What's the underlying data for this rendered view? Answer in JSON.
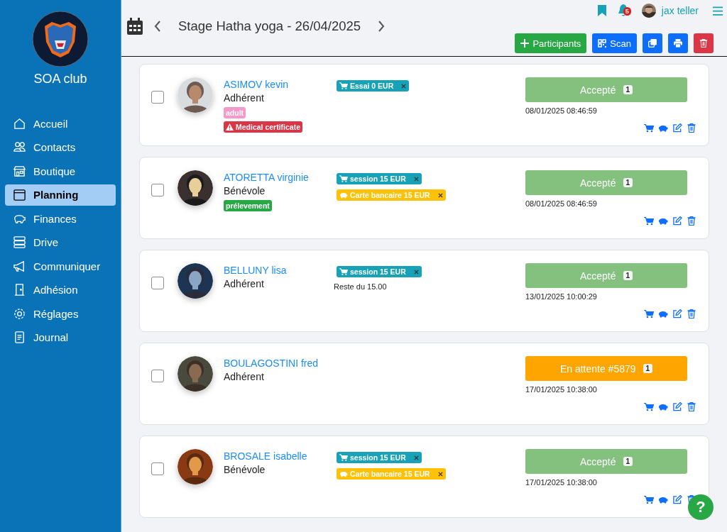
{
  "sidebar": {
    "club_name": "SOA club",
    "items": [
      {
        "label": "Accueil",
        "selected": false
      },
      {
        "label": "Contacts",
        "selected": false
      },
      {
        "label": "Boutique",
        "selected": false
      },
      {
        "label": "Planning",
        "selected": true
      },
      {
        "label": "Finances",
        "selected": false
      },
      {
        "label": "Drive",
        "selected": false
      },
      {
        "label": "Communiquer",
        "selected": false
      },
      {
        "label": "Adhésion",
        "selected": false
      },
      {
        "label": "Réglages",
        "selected": false
      },
      {
        "label": "Journal",
        "selected": false
      }
    ]
  },
  "header": {
    "title": "Stage Hatha yoga - 26/04/2025",
    "notification_count": "5",
    "user_name": "jax teller",
    "buttons": [
      {
        "kind": "participants",
        "label": "Participants"
      },
      {
        "kind": "scan",
        "label": "Scan"
      },
      {
        "kind": "copy"
      },
      {
        "kind": "print"
      },
      {
        "kind": "delete"
      }
    ]
  },
  "rows": [
    {
      "checked": false,
      "name": "ASIMOV kevin",
      "role": "Adhérent",
      "tags": [
        {
          "label": "adult",
          "color": "#f799c8",
          "kind": "plain"
        },
        {
          "label": "Medical certificate",
          "color": "#dc3545",
          "kind": "warning"
        }
      ],
      "items": [
        {
          "kind": "product",
          "label": "Essai 0 EUR"
        }
      ],
      "status": {
        "kind": "accepted",
        "label": "Accepté",
        "count": "1"
      },
      "date": "08/01/2025 08:46:59"
    },
    {
      "checked": false,
      "name": "ATORETTA virginie",
      "role": "Bénévole",
      "tags": [
        {
          "label": "prélevement",
          "color": "#28a745",
          "kind": "plain"
        }
      ],
      "items": [
        {
          "kind": "product",
          "label": "session 15 EUR"
        },
        {
          "kind": "payment",
          "label": "Carte bancaire 15 EUR"
        }
      ],
      "status": {
        "kind": "accepted",
        "label": "Accepté",
        "count": "1"
      },
      "date": "08/01/2025 08:46:59"
    },
    {
      "checked": false,
      "name": "BELLUNY lisa",
      "role": "Adhérent",
      "items": [
        {
          "kind": "product",
          "label": "session 15 EUR"
        }
      ],
      "note": "Reste du 15.00",
      "status": {
        "kind": "accepted",
        "label": "Accepté",
        "count": "1"
      },
      "date": "13/01/2025 10:00:29"
    },
    {
      "checked": false,
      "name": "BOULAGOSTINI fred",
      "role": "Adhérent",
      "status": {
        "kind": "waiting",
        "label": "En attente #5879",
        "count": "1"
      },
      "date": "17/01/2025 10:38:00"
    },
    {
      "checked": false,
      "name": "BROSALE isabelle",
      "role": "Bénévole",
      "items": [
        {
          "kind": "product",
          "label": "session 15 EUR"
        },
        {
          "kind": "payment",
          "label": "Carte bancaire 15 EUR"
        }
      ],
      "status": {
        "kind": "accepted",
        "label": "Accepté",
        "count": "1"
      },
      "date": "17/01/2025 10:38:00"
    }
  ],
  "help_button": {
    "label": "?"
  }
}
